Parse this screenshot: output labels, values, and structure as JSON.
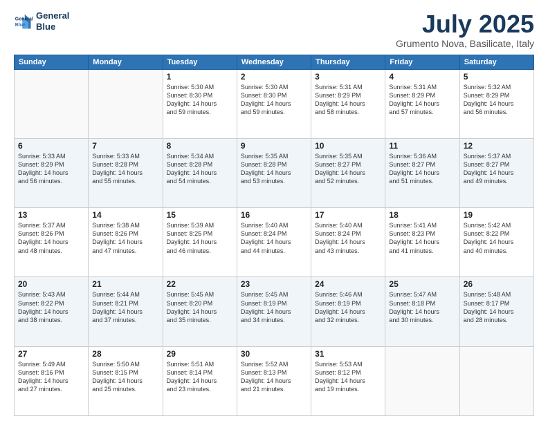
{
  "header": {
    "logo_line1": "General",
    "logo_line2": "Blue",
    "month": "July 2025",
    "location": "Grumento Nova, Basilicate, Italy"
  },
  "weekdays": [
    "Sunday",
    "Monday",
    "Tuesday",
    "Wednesday",
    "Thursday",
    "Friday",
    "Saturday"
  ],
  "weeks": [
    [
      {
        "day": "",
        "content": ""
      },
      {
        "day": "",
        "content": ""
      },
      {
        "day": "1",
        "content": "Sunrise: 5:30 AM\nSunset: 8:30 PM\nDaylight: 14 hours\nand 59 minutes."
      },
      {
        "day": "2",
        "content": "Sunrise: 5:30 AM\nSunset: 8:30 PM\nDaylight: 14 hours\nand 59 minutes."
      },
      {
        "day": "3",
        "content": "Sunrise: 5:31 AM\nSunset: 8:29 PM\nDaylight: 14 hours\nand 58 minutes."
      },
      {
        "day": "4",
        "content": "Sunrise: 5:31 AM\nSunset: 8:29 PM\nDaylight: 14 hours\nand 57 minutes."
      },
      {
        "day": "5",
        "content": "Sunrise: 5:32 AM\nSunset: 8:29 PM\nDaylight: 14 hours\nand 56 minutes."
      }
    ],
    [
      {
        "day": "6",
        "content": "Sunrise: 5:33 AM\nSunset: 8:29 PM\nDaylight: 14 hours\nand 56 minutes."
      },
      {
        "day": "7",
        "content": "Sunrise: 5:33 AM\nSunset: 8:28 PM\nDaylight: 14 hours\nand 55 minutes."
      },
      {
        "day": "8",
        "content": "Sunrise: 5:34 AM\nSunset: 8:28 PM\nDaylight: 14 hours\nand 54 minutes."
      },
      {
        "day": "9",
        "content": "Sunrise: 5:35 AM\nSunset: 8:28 PM\nDaylight: 14 hours\nand 53 minutes."
      },
      {
        "day": "10",
        "content": "Sunrise: 5:35 AM\nSunset: 8:27 PM\nDaylight: 14 hours\nand 52 minutes."
      },
      {
        "day": "11",
        "content": "Sunrise: 5:36 AM\nSunset: 8:27 PM\nDaylight: 14 hours\nand 51 minutes."
      },
      {
        "day": "12",
        "content": "Sunrise: 5:37 AM\nSunset: 8:27 PM\nDaylight: 14 hours\nand 49 minutes."
      }
    ],
    [
      {
        "day": "13",
        "content": "Sunrise: 5:37 AM\nSunset: 8:26 PM\nDaylight: 14 hours\nand 48 minutes."
      },
      {
        "day": "14",
        "content": "Sunrise: 5:38 AM\nSunset: 8:26 PM\nDaylight: 14 hours\nand 47 minutes."
      },
      {
        "day": "15",
        "content": "Sunrise: 5:39 AM\nSunset: 8:25 PM\nDaylight: 14 hours\nand 46 minutes."
      },
      {
        "day": "16",
        "content": "Sunrise: 5:40 AM\nSunset: 8:24 PM\nDaylight: 14 hours\nand 44 minutes."
      },
      {
        "day": "17",
        "content": "Sunrise: 5:40 AM\nSunset: 8:24 PM\nDaylight: 14 hours\nand 43 minutes."
      },
      {
        "day": "18",
        "content": "Sunrise: 5:41 AM\nSunset: 8:23 PM\nDaylight: 14 hours\nand 41 minutes."
      },
      {
        "day": "19",
        "content": "Sunrise: 5:42 AM\nSunset: 8:22 PM\nDaylight: 14 hours\nand 40 minutes."
      }
    ],
    [
      {
        "day": "20",
        "content": "Sunrise: 5:43 AM\nSunset: 8:22 PM\nDaylight: 14 hours\nand 38 minutes."
      },
      {
        "day": "21",
        "content": "Sunrise: 5:44 AM\nSunset: 8:21 PM\nDaylight: 14 hours\nand 37 minutes."
      },
      {
        "day": "22",
        "content": "Sunrise: 5:45 AM\nSunset: 8:20 PM\nDaylight: 14 hours\nand 35 minutes."
      },
      {
        "day": "23",
        "content": "Sunrise: 5:45 AM\nSunset: 8:19 PM\nDaylight: 14 hours\nand 34 minutes."
      },
      {
        "day": "24",
        "content": "Sunrise: 5:46 AM\nSunset: 8:19 PM\nDaylight: 14 hours\nand 32 minutes."
      },
      {
        "day": "25",
        "content": "Sunrise: 5:47 AM\nSunset: 8:18 PM\nDaylight: 14 hours\nand 30 minutes."
      },
      {
        "day": "26",
        "content": "Sunrise: 5:48 AM\nSunset: 8:17 PM\nDaylight: 14 hours\nand 28 minutes."
      }
    ],
    [
      {
        "day": "27",
        "content": "Sunrise: 5:49 AM\nSunset: 8:16 PM\nDaylight: 14 hours\nand 27 minutes."
      },
      {
        "day": "28",
        "content": "Sunrise: 5:50 AM\nSunset: 8:15 PM\nDaylight: 14 hours\nand 25 minutes."
      },
      {
        "day": "29",
        "content": "Sunrise: 5:51 AM\nSunset: 8:14 PM\nDaylight: 14 hours\nand 23 minutes."
      },
      {
        "day": "30",
        "content": "Sunrise: 5:52 AM\nSunset: 8:13 PM\nDaylight: 14 hours\nand 21 minutes."
      },
      {
        "day": "31",
        "content": "Sunrise: 5:53 AM\nSunset: 8:12 PM\nDaylight: 14 hours\nand 19 minutes."
      },
      {
        "day": "",
        "content": ""
      },
      {
        "day": "",
        "content": ""
      }
    ]
  ]
}
